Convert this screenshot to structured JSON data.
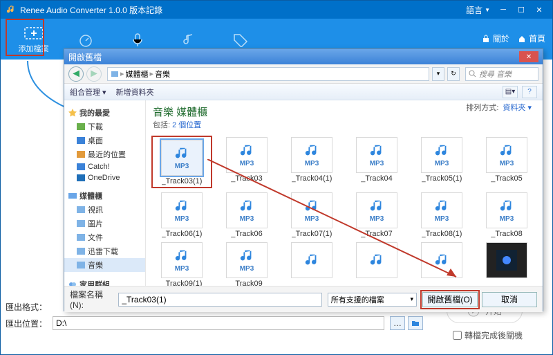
{
  "app": {
    "title": "Renee Audio Converter 1.0.0 版本記錄",
    "langLabel": "語言",
    "aboutLabel": "關於",
    "homeLabel": "首頁"
  },
  "toolbar": {
    "addFile": "添加檔案"
  },
  "dialog": {
    "title": "開啟舊檔",
    "crumb1": "媒體櫃",
    "crumb2": "音樂",
    "searchPlaceholder": "搜尋 音樂",
    "organize": "組合管理",
    "newFolder": "新增資料夾",
    "mainTitle": "音樂 媒體櫃",
    "subLabel": "包括:",
    "subLink": "2 個位置",
    "sortLabel": "排列方式:",
    "sortValue": "資料夾",
    "sidebar": {
      "favHdr": "我的最愛",
      "fav": [
        "下載",
        "桌面",
        "最近的位置",
        "Catch!",
        "OneDrive"
      ],
      "libHdr": "媒體櫃",
      "lib": [
        "視訊",
        "圖片",
        "文件",
        "迅雷下载",
        "音樂"
      ],
      "homeHdr": "家用群組"
    },
    "files": [
      {
        "name": "_Track03(1)",
        "ext": "MP3",
        "sel": true
      },
      {
        "name": "_Track03",
        "ext": "MP3"
      },
      {
        "name": "_Track04(1)",
        "ext": "MP3"
      },
      {
        "name": "_Track04",
        "ext": "MP3"
      },
      {
        "name": "_Track05(1)",
        "ext": "MP3"
      },
      {
        "name": "_Track05",
        "ext": "MP3"
      },
      {
        "name": "_Track06(1)",
        "ext": "MP3"
      },
      {
        "name": "_Track06",
        "ext": "MP3"
      },
      {
        "name": "_Track07(1)",
        "ext": "MP3"
      },
      {
        "name": "_Track07",
        "ext": "MP3"
      },
      {
        "name": "_Track08(1)",
        "ext": "MP3"
      },
      {
        "name": "_Track08",
        "ext": "MP3"
      },
      {
        "name": "_Track09(1)",
        "ext": "MP3"
      },
      {
        "name": "_Track09",
        "ext": "MP3"
      },
      {
        "name": "",
        "ext": ""
      },
      {
        "name": "",
        "ext": ""
      },
      {
        "name": "",
        "ext": ""
      },
      {
        "name": "",
        "ext": "",
        "video": true
      }
    ],
    "fileNameLabel": "檔案名稱(N):",
    "fileNameValue": "_Track03(1)",
    "fileType": "所有支援的檔案",
    "openBtn": "開啟舊檔(O)",
    "cancelBtn": "取消"
  },
  "bottom": {
    "formatLabel": "匯出格式：",
    "locationLabel": "匯出位置：",
    "locationValue": "D:\\",
    "startLabel": "开始",
    "closeAfter": "轉檔完成後關機"
  }
}
